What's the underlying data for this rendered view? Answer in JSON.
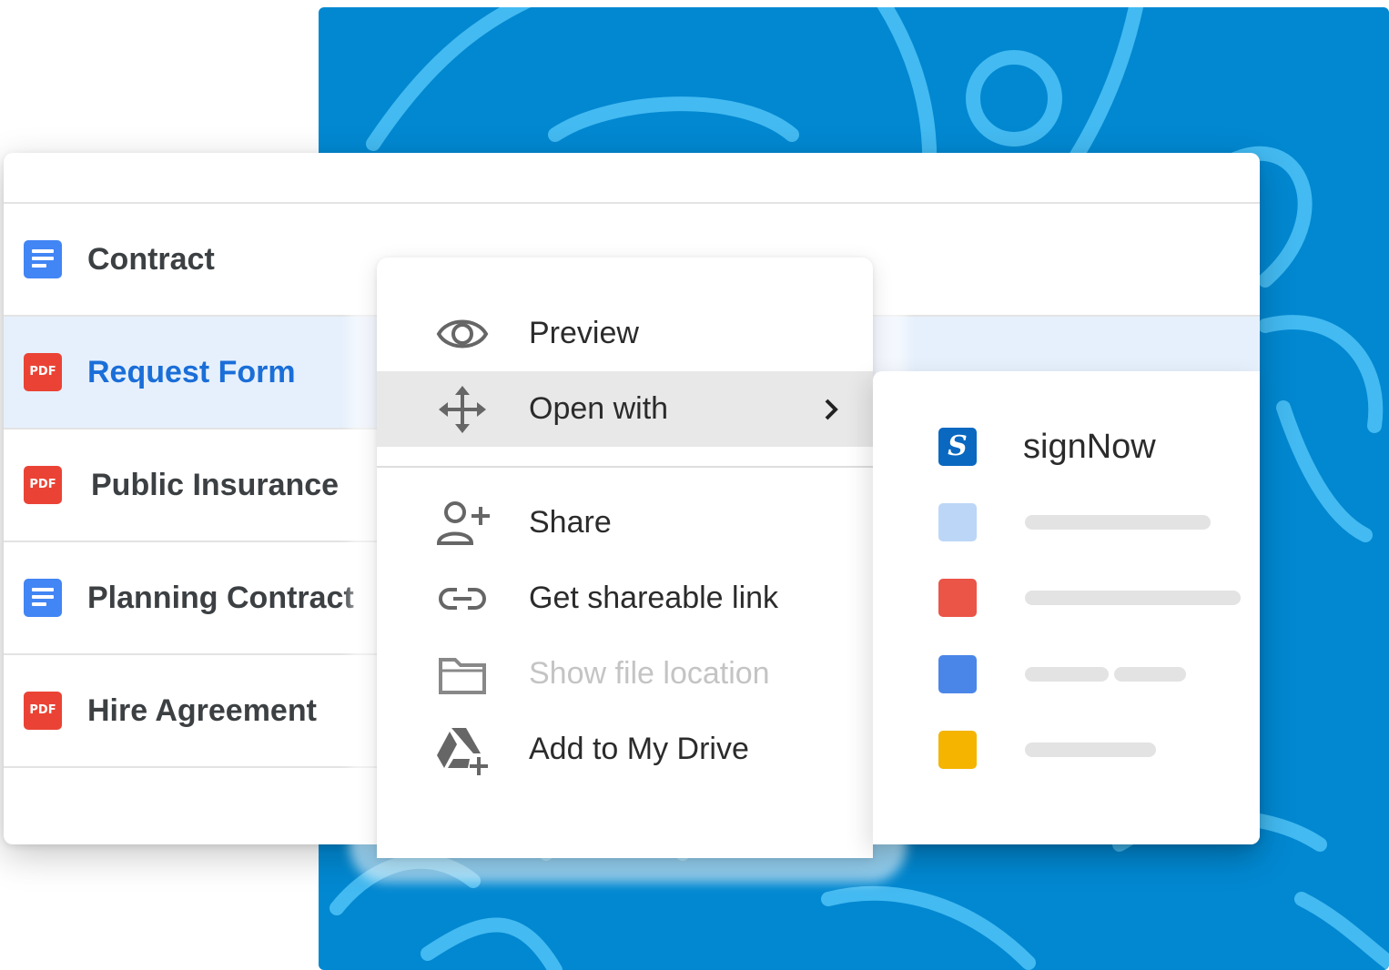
{
  "background": {
    "color": "#0288d1",
    "doodle_color": "#4fc3f7"
  },
  "files": [
    {
      "name": "Contract",
      "type": "doc",
      "icon": "doc-icon",
      "selected": false
    },
    {
      "name": "Request Form",
      "type": "pdf",
      "icon": "pdf-icon",
      "selected": true
    },
    {
      "name": "Public Insurance",
      "type": "pdf",
      "icon": "pdf-icon",
      "selected": false
    },
    {
      "name": "Planning Contract",
      "type": "doc",
      "icon": "doc-icon",
      "selected": false
    },
    {
      "name": "Hire Agreement",
      "type": "pdf",
      "icon": "pdf-icon",
      "selected": false
    }
  ],
  "pdf_badge_text": "PDF",
  "context_menu": {
    "items": [
      {
        "label": "Preview",
        "icon": "eye-icon"
      },
      {
        "label": "Open with",
        "icon": "move-arrows-icon",
        "active": true,
        "has_submenu": true
      },
      {
        "label": "Share",
        "icon": "add-person-icon"
      },
      {
        "label": "Get shareable link",
        "icon": "link-icon"
      },
      {
        "label": "Show file location",
        "icon": "folder-icon",
        "disabled": true
      },
      {
        "label": "Add to My Drive",
        "icon": "drive-add-icon"
      }
    ]
  },
  "submenu": {
    "apps": [
      {
        "label": "signNow",
        "icon": "signnow-logo-icon",
        "color": "#0a68c0",
        "logo_letter": "S"
      },
      {
        "label": "",
        "color": "#bcd6f7"
      },
      {
        "label": "",
        "color": "#ea5548"
      },
      {
        "label": "",
        "color": "#4a86e8"
      },
      {
        "label": "",
        "color": "#f4b400"
      }
    ]
  },
  "colors": {
    "doc_blue": "#4285f4",
    "pdf_red": "#ea4335",
    "selected_row_bg": "#e6f0fc",
    "selected_text": "#1a6ed8",
    "active_menu_bg": "#e8e8e8"
  }
}
